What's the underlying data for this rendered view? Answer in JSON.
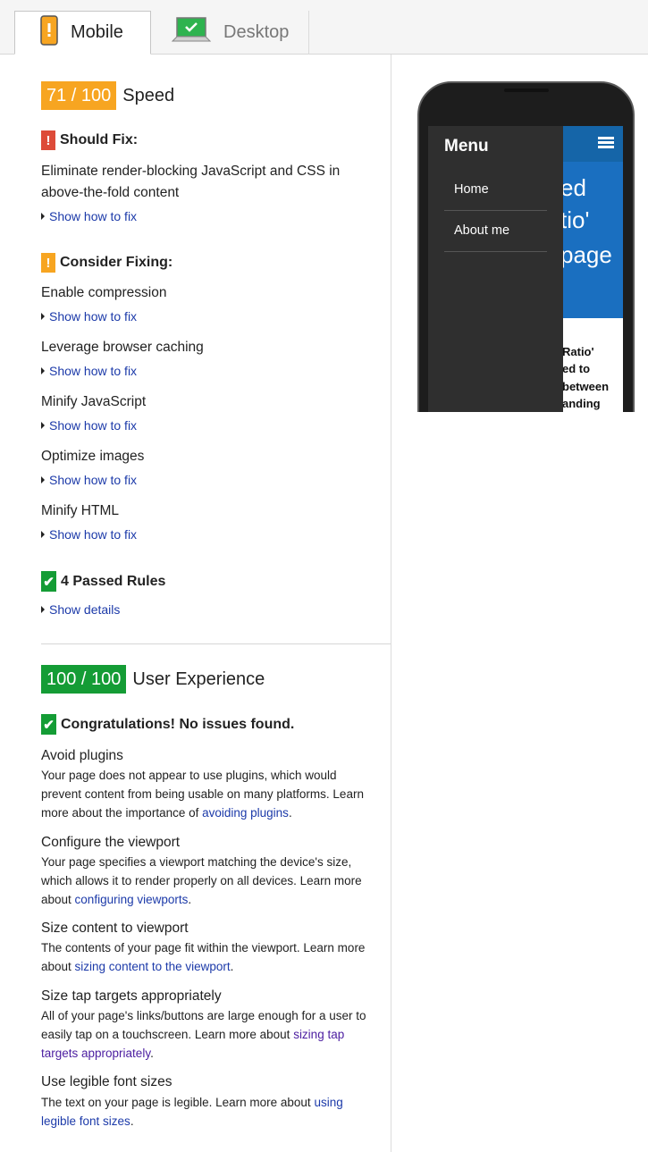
{
  "tabs": [
    {
      "label": "Mobile",
      "icon": "mobile-phone-icon",
      "active": true
    },
    {
      "label": "Desktop",
      "icon": "laptop-icon",
      "active": false
    }
  ],
  "speed": {
    "score": "71 / 100",
    "label": "Speed",
    "should_fix": {
      "title": "Should Fix:",
      "badge": "!",
      "rules": [
        {
          "text": "Eliminate render-blocking JavaScript and CSS in above-the-fold content",
          "link": "Show how to fix"
        }
      ]
    },
    "consider_fixing": {
      "title": "Consider Fixing:",
      "badge": "!",
      "rules": [
        {
          "text": "Enable compression",
          "link": "Show how to fix"
        },
        {
          "text": "Leverage browser caching",
          "link": "Show how to fix"
        },
        {
          "text": "Minify JavaScript",
          "link": "Show how to fix"
        },
        {
          "text": "Optimize images",
          "link": "Show how to fix"
        },
        {
          "text": "Minify HTML",
          "link": "Show how to fix"
        }
      ]
    },
    "passed": {
      "title": "4 Passed Rules",
      "badge": "✔",
      "link": "Show details"
    }
  },
  "ux": {
    "score": "100 / 100",
    "label": "User Experience",
    "congrats": {
      "title": "Congratulations! No issues found.",
      "badge": "✔"
    },
    "rules": [
      {
        "title": "Avoid plugins",
        "desc_before": "Your page does not appear to use plugins, which would prevent content from being usable on many platforms. Learn more about the importance of ",
        "link": "avoiding plugins",
        "desc_after": "."
      },
      {
        "title": "Configure the viewport",
        "desc_before": "Your page specifies a viewport matching the device's size, which allows it to render properly on all devices. Learn more about ",
        "link": "configuring viewports",
        "desc_after": "."
      },
      {
        "title": "Size content to viewport",
        "desc_before": "The contents of your page fit within the viewport. Learn more about ",
        "link": "sizing content to the viewport",
        "desc_after": "."
      },
      {
        "title": "Size tap targets appropriately",
        "desc_before": "All of your page's links/buttons are large enough for a user to easily tap on a touchscreen. Learn more about ",
        "link": "sizing tap targets appropriately",
        "desc_after": "."
      },
      {
        "title": "Use legible font sizes",
        "desc_before": "The text on your page is legible. Learn more about ",
        "link": "using legible font sizes",
        "desc_after": "."
      }
    ]
  },
  "preview": {
    "menu_title": "Menu",
    "menu_items": [
      "Home",
      "About me"
    ],
    "hero_lines": [
      "ed",
      "tio'",
      "page"
    ],
    "body_lines": [
      "Ratio'",
      "ed to",
      "between",
      "anding"
    ]
  },
  "colors": {
    "orange": "#f7a521",
    "red": "#dd4b39",
    "green": "#149c35",
    "link": "#1c3aa9"
  }
}
